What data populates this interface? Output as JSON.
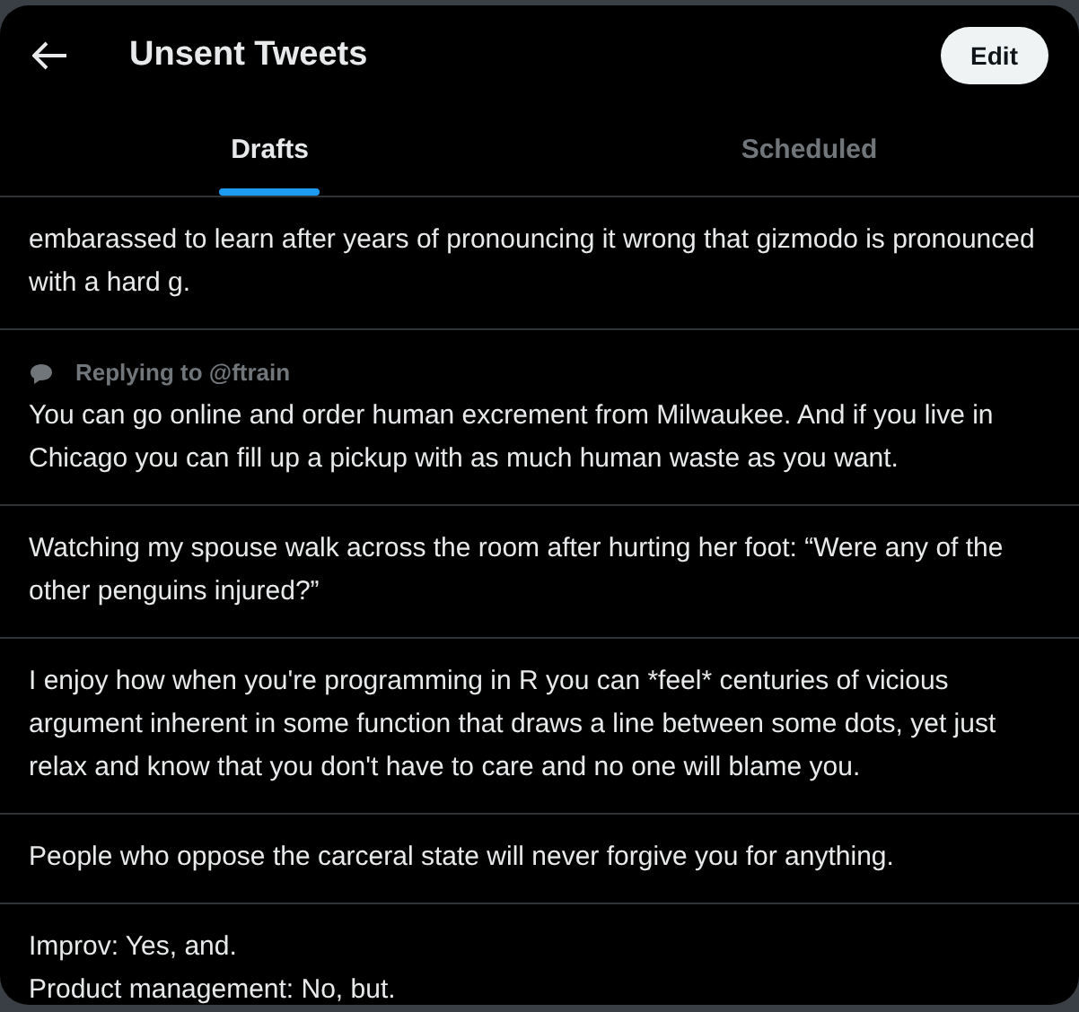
{
  "header": {
    "title": "Unsent Tweets",
    "edit_button": "Edit"
  },
  "tabs": [
    {
      "label": "Drafts",
      "selected": true
    },
    {
      "label": "Scheduled",
      "selected": false
    }
  ],
  "drafts": [
    {
      "text": "embarassed to learn after years of pronouncing it wrong that gizmodo is pronounced with a hard g."
    },
    {
      "reply_to": "Replying to @ftrain",
      "text": "You can go online and order human excrement from Milwaukee. And if you live in Chicago you can fill up a pickup with as much human waste as you want."
    },
    {
      "text": "Watching my spouse walk across the room after hurting her foot: “Were any of the other penguins injured?”"
    },
    {
      "text": "I enjoy how when you're programming in R you can *feel* centuries of vicious argument inherent in some function that draws a line between some dots, yet just relax and know that you don't have to care and no one will blame you."
    },
    {
      "text": "People who oppose the carceral state will never forgive you for anything."
    },
    {
      "text": "Improv: Yes, and.\nProduct management: No, but."
    }
  ]
}
